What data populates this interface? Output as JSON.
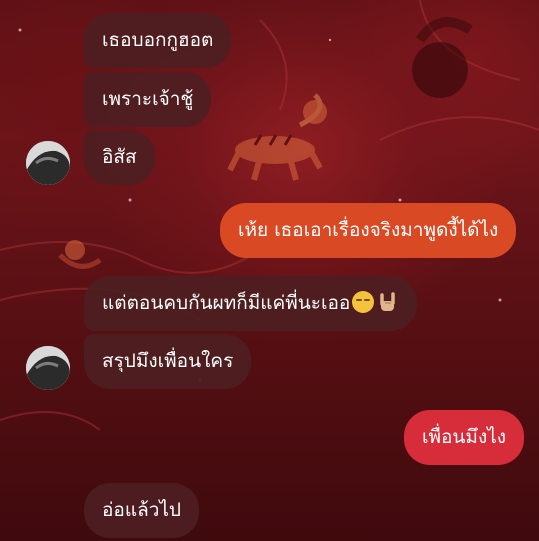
{
  "chat": {
    "messages": [
      {
        "side": "incoming",
        "text": "เธอบอกกูฮอต"
      },
      {
        "side": "incoming",
        "text": "เพราะเจ้าชู้"
      },
      {
        "side": "incoming",
        "text": "อิสัส"
      },
      {
        "side": "outgoing",
        "text": "เห้ย เธอเอาเรื่องจริงมาพูดงี้ได้ไง"
      },
      {
        "side": "incoming",
        "text": "แต่ตอนคบกันผทก็มีแค่พี่นะเออ",
        "emojis": [
          "pensive-face-emoji",
          "sign-of-horns-emoji"
        ]
      },
      {
        "side": "incoming",
        "text": "สรุปมึงเพื่อนใคร"
      },
      {
        "side": "outgoing",
        "text": "เพื่อนมึงไง"
      },
      {
        "side": "incoming",
        "text": "อ่อแล้วไป"
      }
    ]
  },
  "colors": {
    "background": "#5c1116",
    "incoming_bubble": "#4e1e21",
    "outgoing_bubble_orange": "#d94a24",
    "outgoing_bubble_red": "#d72d3a",
    "text": "#ffffff"
  }
}
